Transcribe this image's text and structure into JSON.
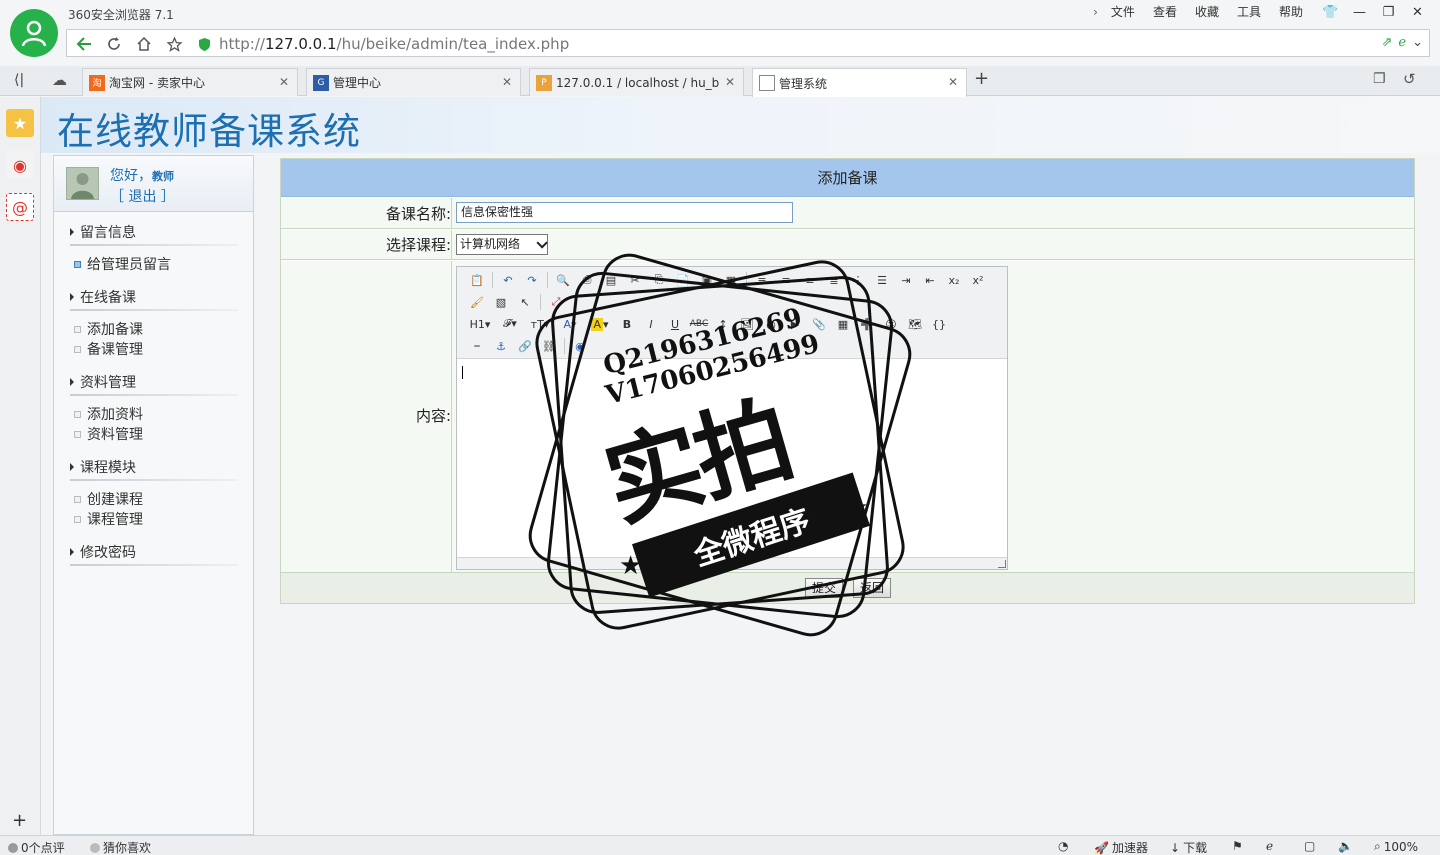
{
  "browser": {
    "name": "360安全浏览器 7.1",
    "menu": [
      "文件",
      "查看",
      "收藏",
      "工具",
      "帮助"
    ],
    "url_prefix": "http://",
    "url_host": "127.0.0.1",
    "url_path": "/hu/beike/admin/tea_index.php"
  },
  "tabs": [
    {
      "label": "淘宝网 - 卖家中心",
      "active": false
    },
    {
      "label": "管理中心",
      "active": false
    },
    {
      "label": "127.0.0.1 / localhost / hu_b",
      "active": false
    },
    {
      "label": "管理系统",
      "active": true
    }
  ],
  "page": {
    "site_title": "在线教师备课系统",
    "user": {
      "greeting": "您好，",
      "role": "教师",
      "logout": "［ 退出 ］"
    },
    "nav": [
      {
        "label": "留言信息",
        "items": [
          "给管理员留言"
        ]
      },
      {
        "label": "在线备课",
        "items": [
          "添加备课",
          "备课管理"
        ]
      },
      {
        "label": "资料管理",
        "items": [
          "添加资料",
          "资料管理"
        ]
      },
      {
        "label": "课程模块",
        "items": [
          "创建课程",
          "课程管理"
        ]
      },
      {
        "label": "修改密码",
        "items": []
      }
    ],
    "form": {
      "heading": "添加备课",
      "name_label": "备课名称:",
      "name_value": "信息保密性强",
      "course_label": "选择课程:",
      "course_value": "计算机网络",
      "content_label": "内容:",
      "submit": "提交",
      "back": "返回"
    }
  },
  "stamp": {
    "line1": "Q2196316269",
    "line2": "V1706025649​9",
    "big": "实拍",
    "ribbon": "全微程序"
  },
  "statusbar": {
    "comments": "0个点评",
    "guess": "猜你喜欢",
    "accelerator": "加速器",
    "download": "下载",
    "zoom": "100%"
  },
  "colors": {
    "title_blue": "#1d6fb3",
    "form_header": "#a4c6ec",
    "browser_green": "#26b14b"
  }
}
